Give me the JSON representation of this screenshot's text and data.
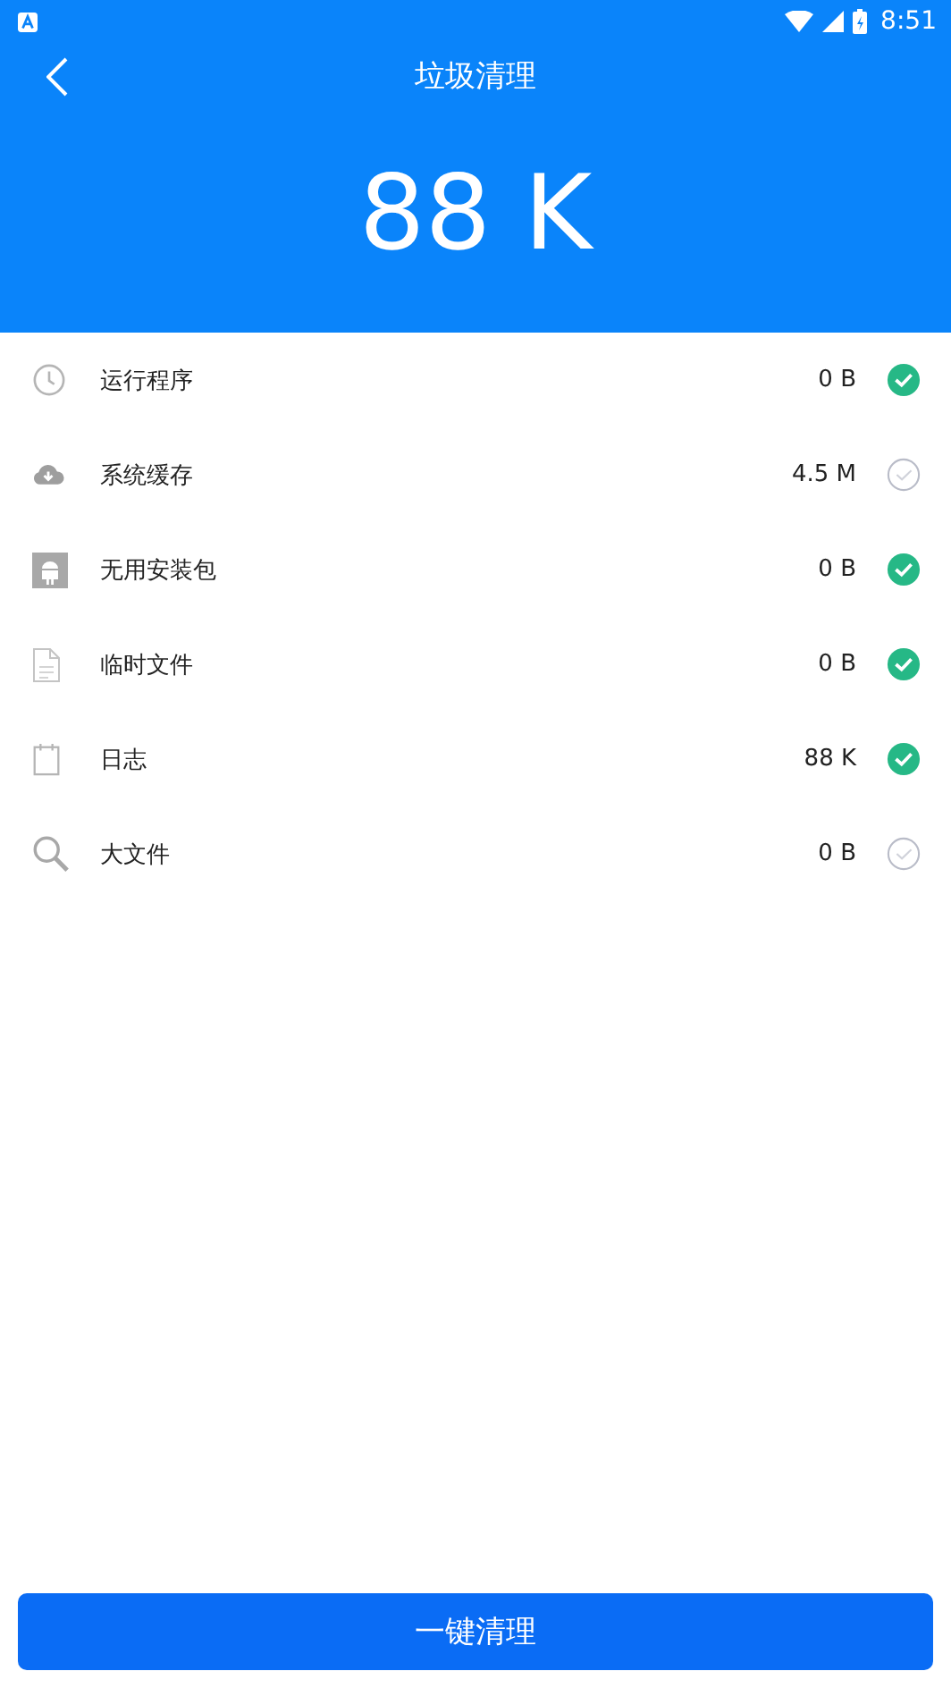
{
  "status_bar": {
    "time": "8:51"
  },
  "header": {
    "title": "垃圾清理",
    "total": "88 K"
  },
  "items": [
    {
      "kind": "clock",
      "label": "运行程序",
      "size": "0 B",
      "checked": true
    },
    {
      "kind": "cloud",
      "label": "系统缓存",
      "size": "4.5 M",
      "checked": false
    },
    {
      "kind": "android",
      "label": "无用安装包",
      "size": "0 B",
      "checked": true
    },
    {
      "kind": "file",
      "label": "临时文件",
      "size": "0 B",
      "checked": true
    },
    {
      "kind": "calendar",
      "label": "日志",
      "size": "88 K",
      "checked": true
    },
    {
      "kind": "search",
      "label": "大文件",
      "size": "0 B",
      "checked": false
    }
  ],
  "clean_button": "一键清理"
}
